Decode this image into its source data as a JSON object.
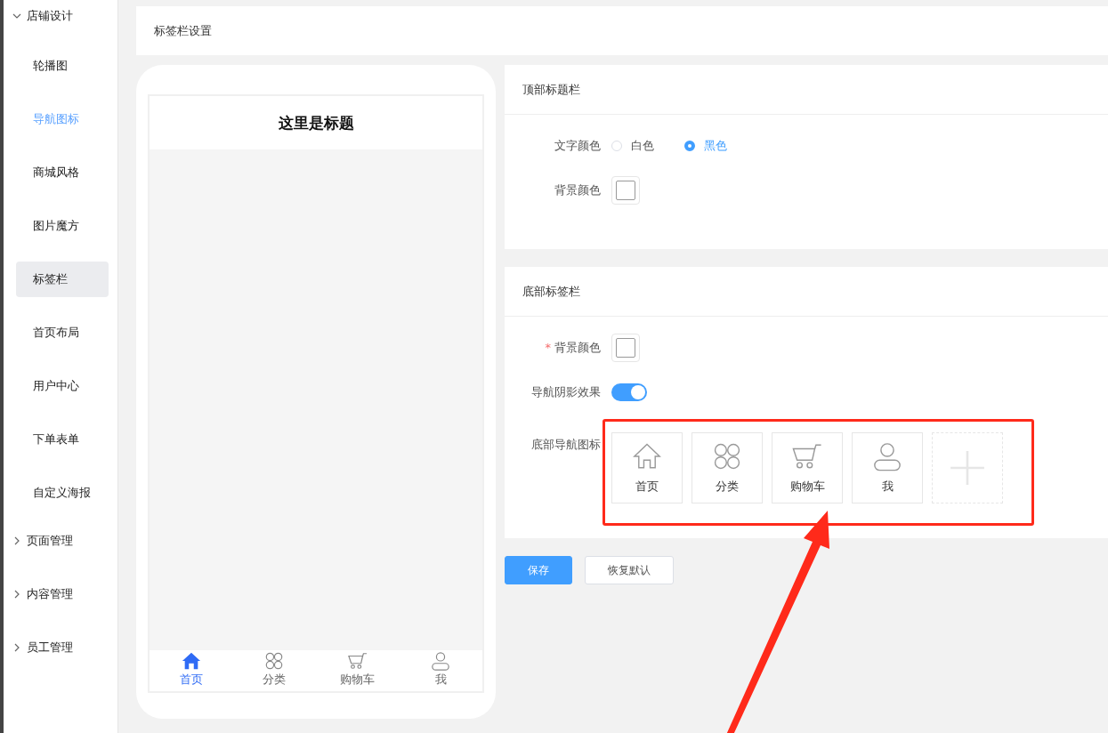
{
  "sidebar": {
    "groups": [
      {
        "label": "店铺设计",
        "expanded": true,
        "items": [
          {
            "label": "轮播图",
            "selected": false,
            "active": false
          },
          {
            "label": "导航图标",
            "selected": false,
            "active": true
          },
          {
            "label": "商城风格",
            "selected": false,
            "active": false
          },
          {
            "label": "图片魔方",
            "selected": false,
            "active": false
          },
          {
            "label": "标签栏",
            "selected": true,
            "active": false
          },
          {
            "label": "首页布局",
            "selected": false,
            "active": false
          },
          {
            "label": "用户中心",
            "selected": false,
            "active": false
          },
          {
            "label": "下单表单",
            "selected": false,
            "active": false
          },
          {
            "label": "自定义海报",
            "selected": false,
            "active": false
          }
        ]
      },
      {
        "label": "页面管理",
        "expanded": false
      },
      {
        "label": "内容管理",
        "expanded": false
      },
      {
        "label": "员工管理",
        "expanded": false
      }
    ]
  },
  "page_title": "标签栏设置",
  "preview": {
    "title": "这里是标题",
    "tabs": [
      {
        "label": "首页",
        "kind": "home",
        "selected": true
      },
      {
        "label": "分类",
        "kind": "grid",
        "selected": false
      },
      {
        "label": "购物车",
        "kind": "cart",
        "selected": false
      },
      {
        "label": "我",
        "kind": "user",
        "selected": false
      }
    ]
  },
  "top_bar": {
    "heading": "顶部标题栏",
    "text_color_label": "文字颜色",
    "text_color_options": [
      {
        "label": "白色",
        "selected": false
      },
      {
        "label": "黑色",
        "selected": true
      }
    ],
    "bg_color_label": "背景颜色"
  },
  "bottom_bar": {
    "heading": "底部标签栏",
    "bg_color_label": "背景颜色",
    "required_mark": "*",
    "shadow_label": "导航阴影效果",
    "shadow_on": true,
    "icons_label": "底部导航图标",
    "icons": [
      {
        "label": "首页",
        "kind": "home"
      },
      {
        "label": "分类",
        "kind": "grid"
      },
      {
        "label": "购物车",
        "kind": "cart"
      },
      {
        "label": "我",
        "kind": "user"
      }
    ]
  },
  "buttons": {
    "save": "保存",
    "reset": "恢复默认"
  }
}
